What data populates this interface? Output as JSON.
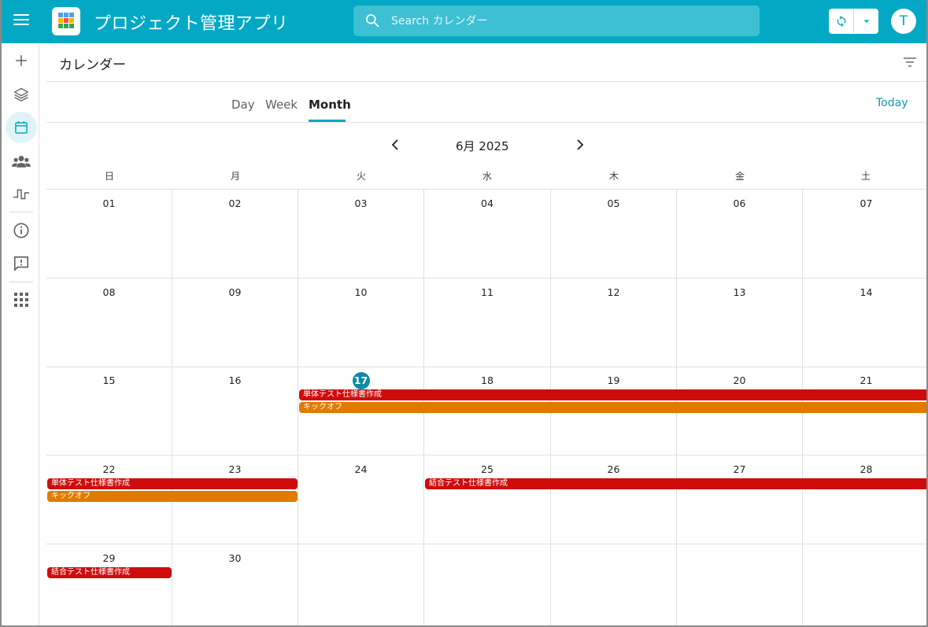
{
  "app": {
    "title": "プロジェクト管理アプリ"
  },
  "search": {
    "placeholder": "Search カレンダー"
  },
  "user": {
    "initial": "T"
  },
  "page": {
    "title": "カレンダー"
  },
  "tabs": [
    {
      "label": "Day"
    },
    {
      "label": "Week"
    },
    {
      "label": "Month"
    }
  ],
  "today_label": "Today",
  "month_label": "6月 2025",
  "weekdays": [
    "日",
    "月",
    "火",
    "水",
    "木",
    "金",
    "土"
  ],
  "weeks": [
    [
      "01",
      "02",
      "03",
      "04",
      "05",
      "06",
      "07"
    ],
    [
      "08",
      "09",
      "10",
      "11",
      "12",
      "13",
      "14"
    ],
    [
      "15",
      "16",
      "17",
      "18",
      "19",
      "20",
      "21"
    ],
    [
      "22",
      "23",
      "24",
      "25",
      "26",
      "27",
      "28"
    ],
    [
      "29",
      "30",
      "",
      "",
      "",
      "",
      ""
    ]
  ],
  "today": "17",
  "events": [
    {
      "title": "単体テスト仕様書作成",
      "color": "#cf0c0c"
    },
    {
      "title": "キックオフ",
      "color": "#e07b00"
    },
    {
      "title": "単体テスト仕様書作成",
      "color": "#cf0c0c"
    },
    {
      "title": "キックオフ",
      "color": "#e07b00"
    },
    {
      "title": "結合テスト仕様書作成",
      "color": "#cf0c0c"
    },
    {
      "title": "結合テスト仕様書作成",
      "color": "#cf0c0c"
    }
  ],
  "colors": {
    "accent": "#03a9c4",
    "today_badge": "#0e8aa6",
    "event_red": "#cf0c0c",
    "event_orange": "#e07b00"
  },
  "icons": {
    "menu": "menu-icon",
    "search": "search-icon",
    "sync": "sync-icon",
    "dropdown": "arrow-drop-down-icon",
    "rail": [
      "add-icon",
      "layers-icon",
      "calendar-icon",
      "people-icon",
      "pulse-icon",
      "info-icon",
      "feedback-icon",
      "apps-icon"
    ],
    "filter": "filter-icon"
  }
}
